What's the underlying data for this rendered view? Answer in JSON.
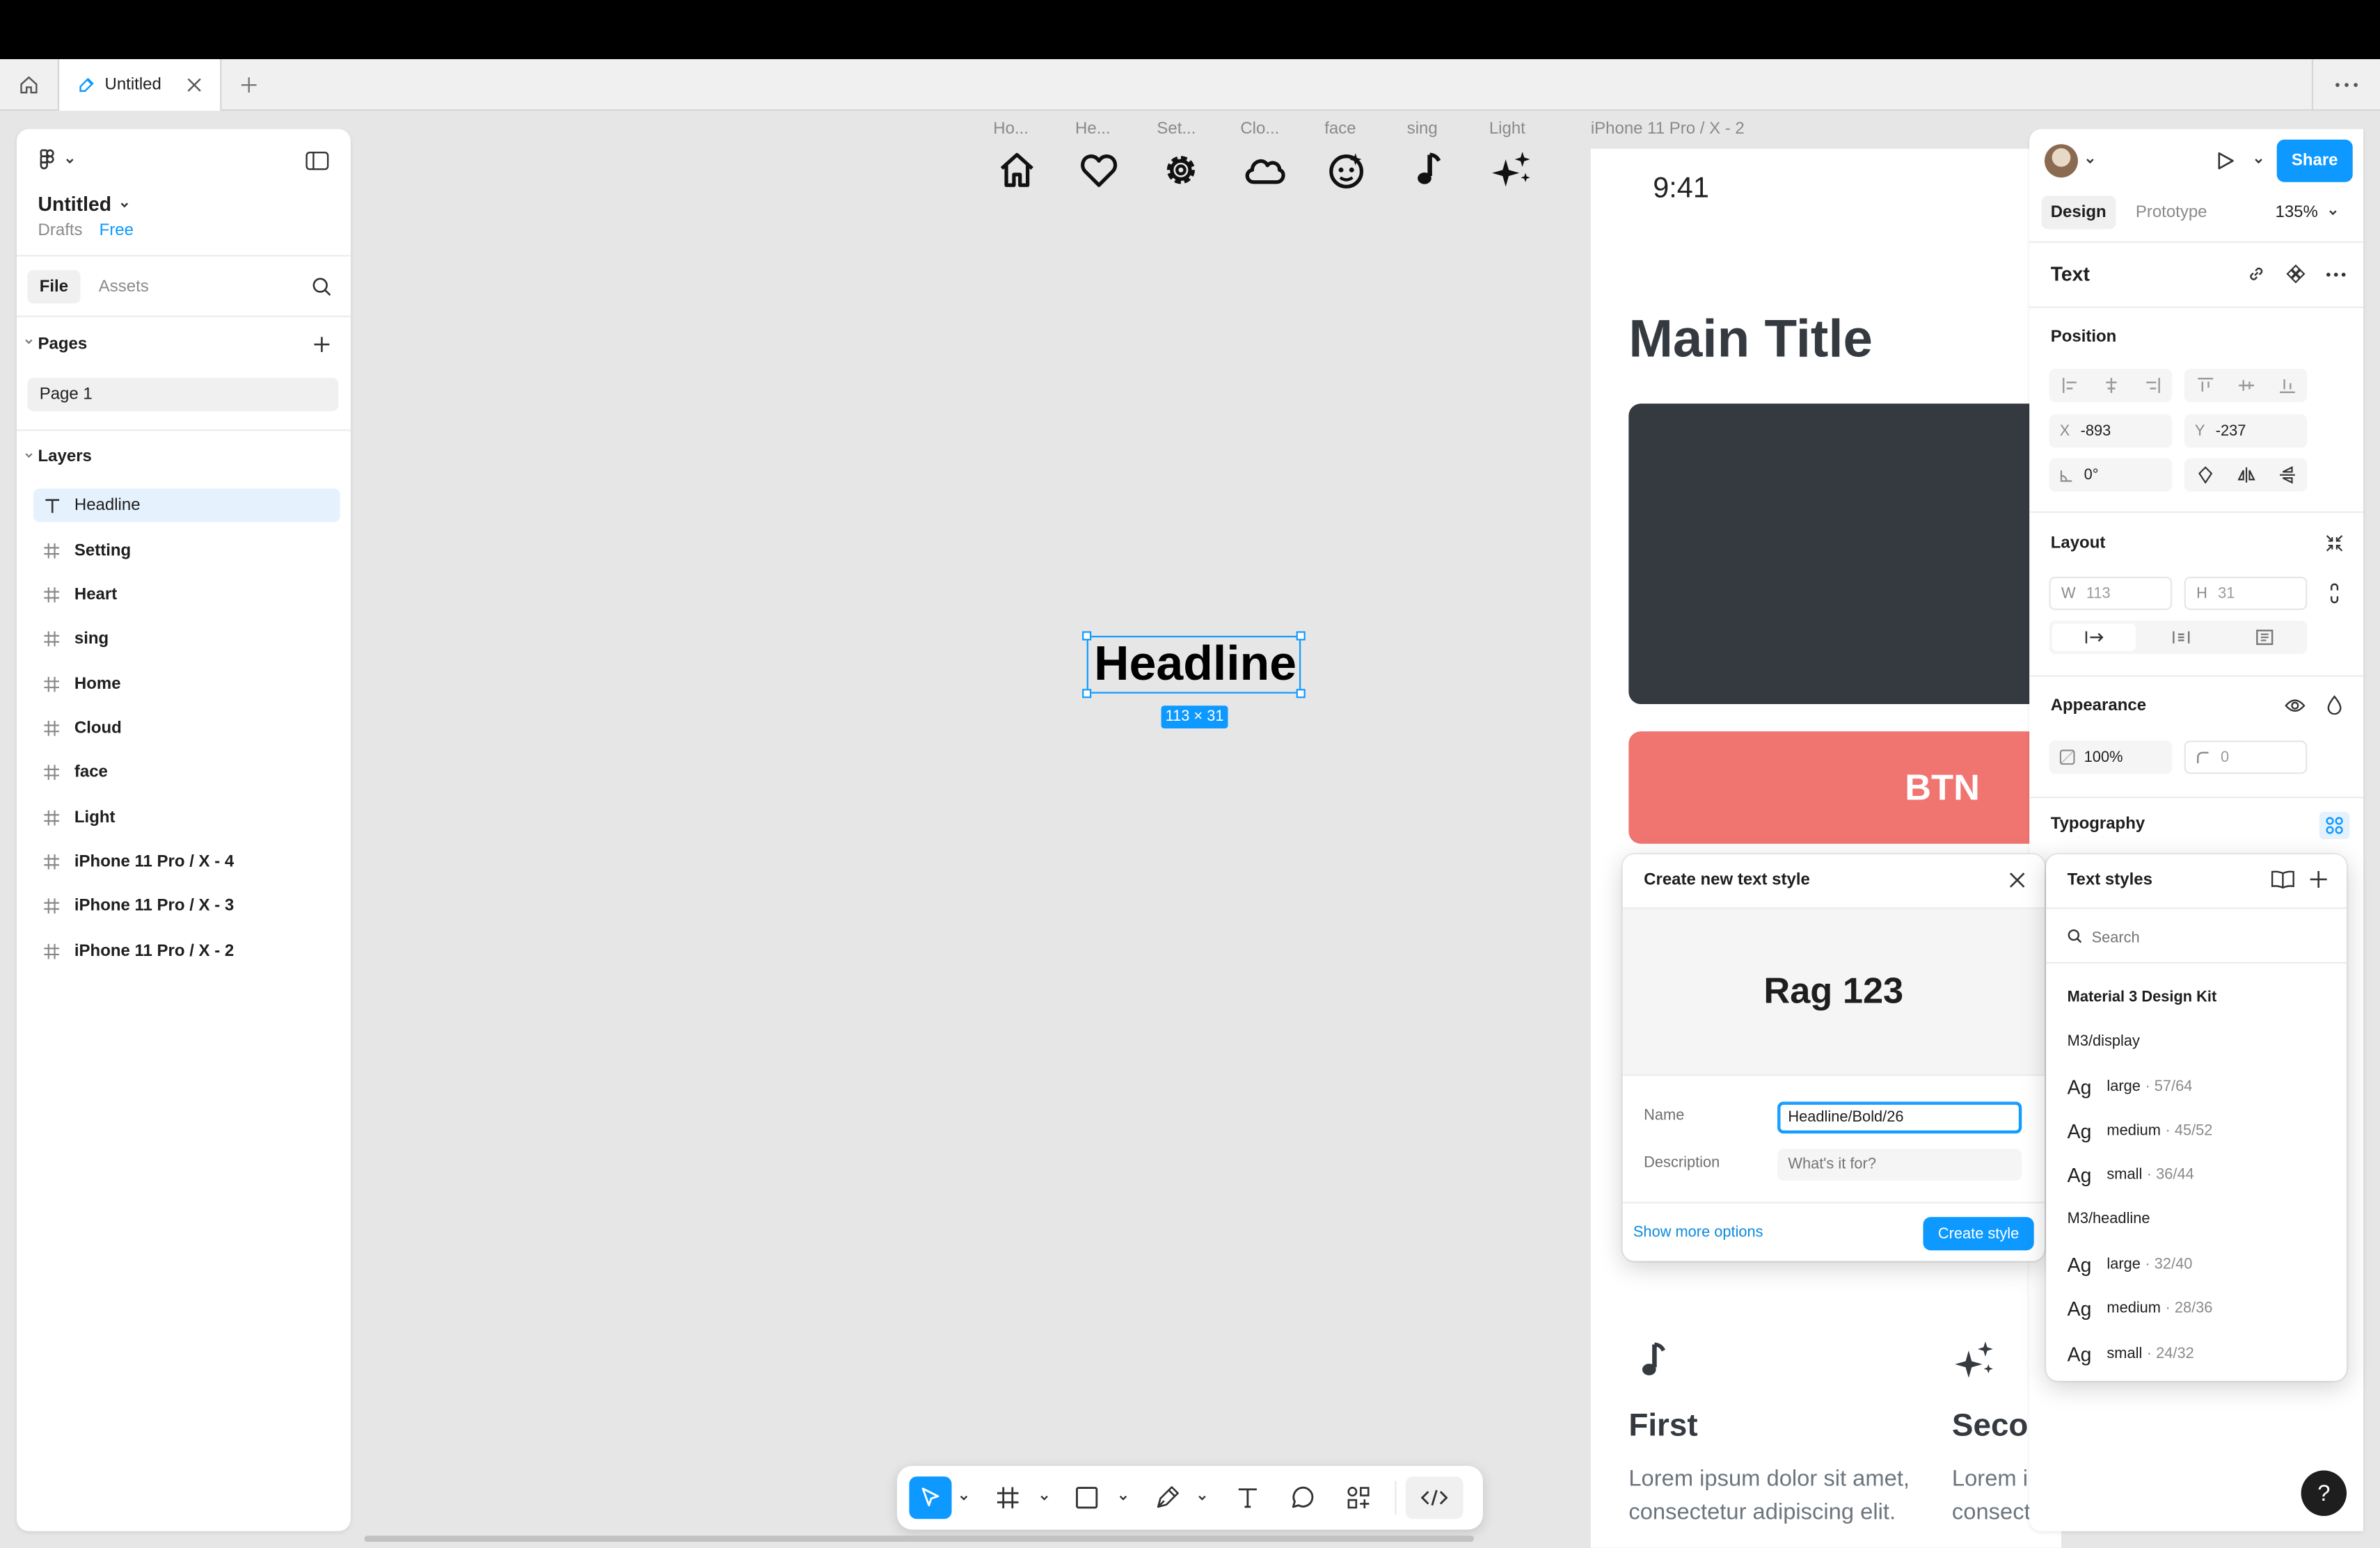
{
  "tabs": {
    "home_label": "Home",
    "doc_title": "Untitled",
    "add_label": "+",
    "more_label": "..."
  },
  "left_panel": {
    "file_title": "Untitled",
    "drafts": "Drafts",
    "plan": "Free",
    "tabs": [
      "File",
      "Assets"
    ],
    "pages_label": "Pages",
    "pages": [
      "Page 1"
    ],
    "layers_label": "Layers",
    "layers": [
      "Headline",
      "Setting",
      "Heart",
      "sing",
      "Home",
      "Cloud",
      "face",
      "Light",
      "iPhone 11 Pro / X - 4",
      "iPhone 11 Pro / X - 3",
      "iPhone 11 Pro / X - 2"
    ]
  },
  "canvas": {
    "icon_labels": [
      "Ho...",
      "He...",
      "Set...",
      "Clo...",
      "face",
      "sing",
      "Light"
    ],
    "frame_label": "iPhone 11 Pro / X - 2",
    "headline": "Headline",
    "size_badge": "113 × 31",
    "phone": {
      "time": "9:41",
      "main_title": "Main Title",
      "btn": "BTN",
      "card1_title": "First",
      "card1_text": "Lorem ipsum dolor sit amet, consectetur adipiscing elit.",
      "card2_title": "Secor",
      "card2_text": "Lorem i consect"
    }
  },
  "right_panel": {
    "share": "Share",
    "tabs": [
      "Design",
      "Prototype"
    ],
    "zoom": "135%",
    "section_title": "Text",
    "position_label": "Position",
    "x_key": "X",
    "x": "-893",
    "y_key": "Y",
    "y": "-237",
    "rotation": "0°",
    "layout_label": "Layout",
    "w_key": "W",
    "w": "113",
    "h_key": "H",
    "h": "31",
    "appearance_label": "Appearance",
    "opacity": "100%",
    "radius": "0",
    "typography_label": "Typography"
  },
  "create_style": {
    "title": "Create new text style",
    "preview": "Rag 123",
    "name_label": "Name",
    "name_value": "Headline/Bold/26",
    "desc_label": "Description",
    "desc_placeholder": "What's it for?",
    "more_options": "Show more options",
    "create_btn": "Create style"
  },
  "text_styles": {
    "title": "Text styles",
    "search_placeholder": "Search",
    "kit": "Material 3 Design Kit",
    "groups": [
      {
        "name": "M3/display",
        "items": [
          {
            "ag": "Ag",
            "name": "large",
            "size": "· 57/64"
          },
          {
            "ag": "Ag",
            "name": "medium",
            "size": "· 45/52"
          },
          {
            "ag": "Ag",
            "name": "small",
            "size": "· 36/44"
          }
        ]
      },
      {
        "name": "M3/headline",
        "items": [
          {
            "ag": "Ag",
            "name": "large",
            "size": "· 32/40"
          },
          {
            "ag": "Ag",
            "name": "medium",
            "size": "· 28/36"
          },
          {
            "ag": "Ag",
            "name": "small",
            "size": "· 24/32"
          }
        ]
      }
    ]
  },
  "help": "?",
  "colors": {
    "accent": "#0d99ff",
    "selection": "#e5f1fd",
    "dark_card": "#343a40",
    "btn_red": "#f07470"
  }
}
